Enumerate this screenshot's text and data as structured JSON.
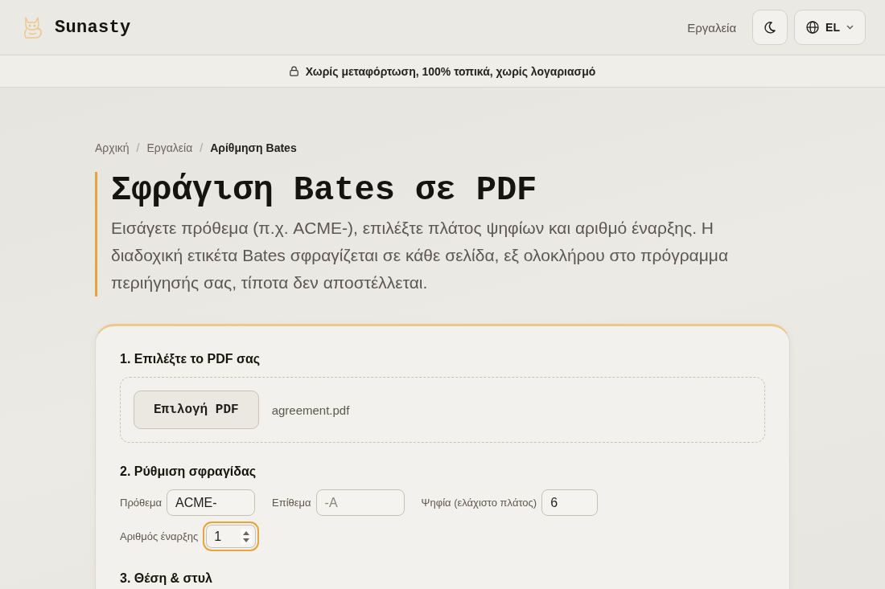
{
  "header": {
    "brand": "Sunasty",
    "nav_link": "Εργαλεία",
    "language": "EL"
  },
  "banner": {
    "text": "Χωρίς μεταφόρτωση, 100% τοπικά, χωρίς λογαριασμό"
  },
  "breadcrumb": {
    "items": [
      {
        "label": "Αρχική",
        "current": false,
        "separator": "/"
      },
      {
        "label": "Εργαλεία",
        "current": false,
        "separator": "/"
      },
      {
        "label": "Αρίθμηση Bates",
        "current": true
      }
    ]
  },
  "hero": {
    "title": "Σφράγιση Bates σε PDF",
    "description": "Εισάγετε πρόθεμα (π.χ. ACME-), επιλέξτε πλάτος ψηφίων και αριθμό έναρξης. Η διαδοχική ετικέτα Bates σφραγίζεται σε κάθε σελίδα, εξ ολοκλήρου στο πρόγραμμα περιήγησής σας, τίποτα δεν αποστέλλεται."
  },
  "card": {
    "sections": [
      {
        "kind": "file",
        "heading": "1. Επιλέξτε το PDF σας",
        "button": "Επιλογή PDF",
        "filename": "agreement.pdf"
      },
      {
        "kind": "fields",
        "heading": "2. Ρύθμιση σφραγίδας",
        "fields": [
          {
            "kind": "text",
            "label": "Πρόθεμα",
            "value": "ACME-",
            "focused": false
          },
          {
            "kind": "text",
            "label": "Επίθεμα",
            "placeholder": "-A",
            "focused": false
          },
          {
            "kind": "text",
            "label": "Ψηφία (ελάχιστο πλάτος)",
            "value": "6",
            "focused": false
          },
          {
            "kind": "number",
            "label": "Αριθμός έναρξης",
            "value": "1",
            "focused": true
          }
        ]
      },
      {
        "kind": "heading",
        "heading": "3. Θέση & στυλ"
      }
    ]
  }
}
